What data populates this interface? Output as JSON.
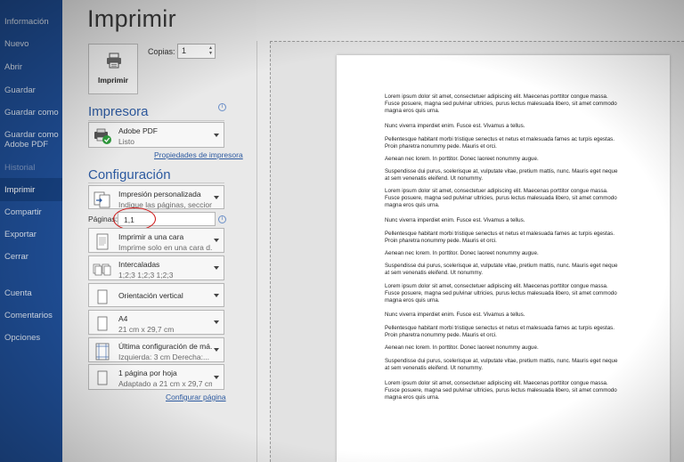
{
  "sidebar": {
    "items": [
      {
        "label": "Información",
        "state": "normal"
      },
      {
        "label": "Nuevo",
        "state": "normal"
      },
      {
        "label": "Abrir",
        "state": "normal"
      },
      {
        "label": "Guardar",
        "state": "normal"
      },
      {
        "label": "Guardar como",
        "state": "normal"
      },
      {
        "label": "Guardar como Adobe PDF",
        "state": "normal"
      },
      {
        "label": "Historial",
        "state": "disabled"
      },
      {
        "label": "Imprimir",
        "state": "active"
      },
      {
        "label": "Compartir",
        "state": "normal"
      },
      {
        "label": "Exportar",
        "state": "normal"
      },
      {
        "label": "Cerrar",
        "state": "normal"
      },
      {
        "label": "Cuenta",
        "state": "normal"
      },
      {
        "label": "Comentarios",
        "state": "normal"
      },
      {
        "label": "Opciones",
        "state": "normal"
      }
    ]
  },
  "page_title": "Imprimir",
  "print_button": {
    "label": "Imprimir",
    "icon": "printer-icon"
  },
  "copies": {
    "label": "Copias:",
    "value": "1"
  },
  "printer": {
    "section_title": "Impresora",
    "name": "Adobe PDF",
    "status": "Listo",
    "properties_link": "Propiedades de impresora"
  },
  "settings": {
    "section_title": "Configuración",
    "range": {
      "title": "Impresión personalizada",
      "subtitle": "Indique las páginas, seccion..."
    },
    "pages": {
      "label": "Páginas:",
      "value": "1,1"
    },
    "sides": {
      "title": "Imprimir a una cara",
      "subtitle": "Imprime solo en una cara d..."
    },
    "collate": {
      "title": "Intercaladas",
      "subtitle": "1;2;3    1;2;3    1;2;3"
    },
    "orientation": {
      "title": "Orientación vertical"
    },
    "paper": {
      "title": "A4",
      "subtitle": "21 cm x 29,7 cm"
    },
    "margins": {
      "title": "Última configuración de má...",
      "subtitle": "Izquierda: 3 cm    Derecha:..."
    },
    "per_sheet": {
      "title": "1 página por hoja",
      "subtitle": "Adaptado a 21 cm x 29,7 cm"
    },
    "page_setup_link": "Configurar página"
  },
  "preview": {
    "paragraphs": [
      "Lorem ipsum dolor sit amet, consectetuer adipiscing elit. Maecenas porttitor congue massa. Fusce posuere, magna sed pulvinar ultricies, purus lectus malesuada libero, sit amet commodo magna eros quis urna.",
      "Nunc viverra imperdiet enim. Fusce est. Vivamus a tellus.",
      "Pellentesque habitant morbi tristique senectus et netus et malesuada fames ac turpis egestas. Proin pharetra nonummy pede. Mauris et orci.",
      "Aenean nec lorem. In porttitor. Donec laoreet nonummy augue.",
      "Suspendisse dui purus, scelerisque at, vulputate vitae, pretium mattis, nunc. Mauris eget neque at sem venenatis eleifend. Ut nonummy.",
      "Lorem ipsum dolor sit amet, consectetuer adipiscing elit. Maecenas porttitor congue massa. Fusce posuere, magna sed pulvinar ultricies, purus lectus malesuada libero, sit amet commodo magna eros quis urna.",
      "Nunc viverra imperdiet enim. Fusce est. Vivamus a tellus.",
      "Pellentesque habitant morbi tristique senectus et netus et malesuada fames ac turpis egestas. Proin pharetra nonummy pede. Mauris et orci.",
      "Aenean nec lorem. In porttitor. Donec laoreet nonummy augue.",
      "Suspendisse dui purus, scelerisque at, vulputate vitae, pretium mattis, nunc. Mauris eget neque at sem venenatis eleifend. Ut nonummy.",
      "Lorem ipsum dolor sit amet, consectetuer adipiscing elit. Maecenas porttitor congue massa. Fusce posuere, magna sed pulvinar ultricies, purus lectus malesuada libero, sit amet commodo magna eros quis urna.",
      "Nunc viverra imperdiet enim. Fusce est. Vivamus a tellus.",
      "Pellentesque habitant morbi tristique senectus et netus et malesuada fames ac turpis egestas. Proin pharetra nonummy pede. Mauris et orci.",
      "Aenean nec lorem. In porttitor. Donec laoreet nonummy augue.",
      "Suspendisse dui purus, scelerisque at, vulputate vitae, pretium mattis, nunc. Mauris eget neque at sem venenatis eleifend. Ut nonummy.",
      "Lorem ipsum dolor sit amet, consectetuer adipiscing elit. Maecenas porttitor congue massa. Fusce posuere, magna sed pulvinar ultricies, purus lectus malesuada libero, sit amet commodo magna eros quis urna."
    ]
  },
  "colors": {
    "sidebar": "#1f4e96",
    "accent": "#2d5aa0",
    "highlight_circle": "#d01818"
  }
}
